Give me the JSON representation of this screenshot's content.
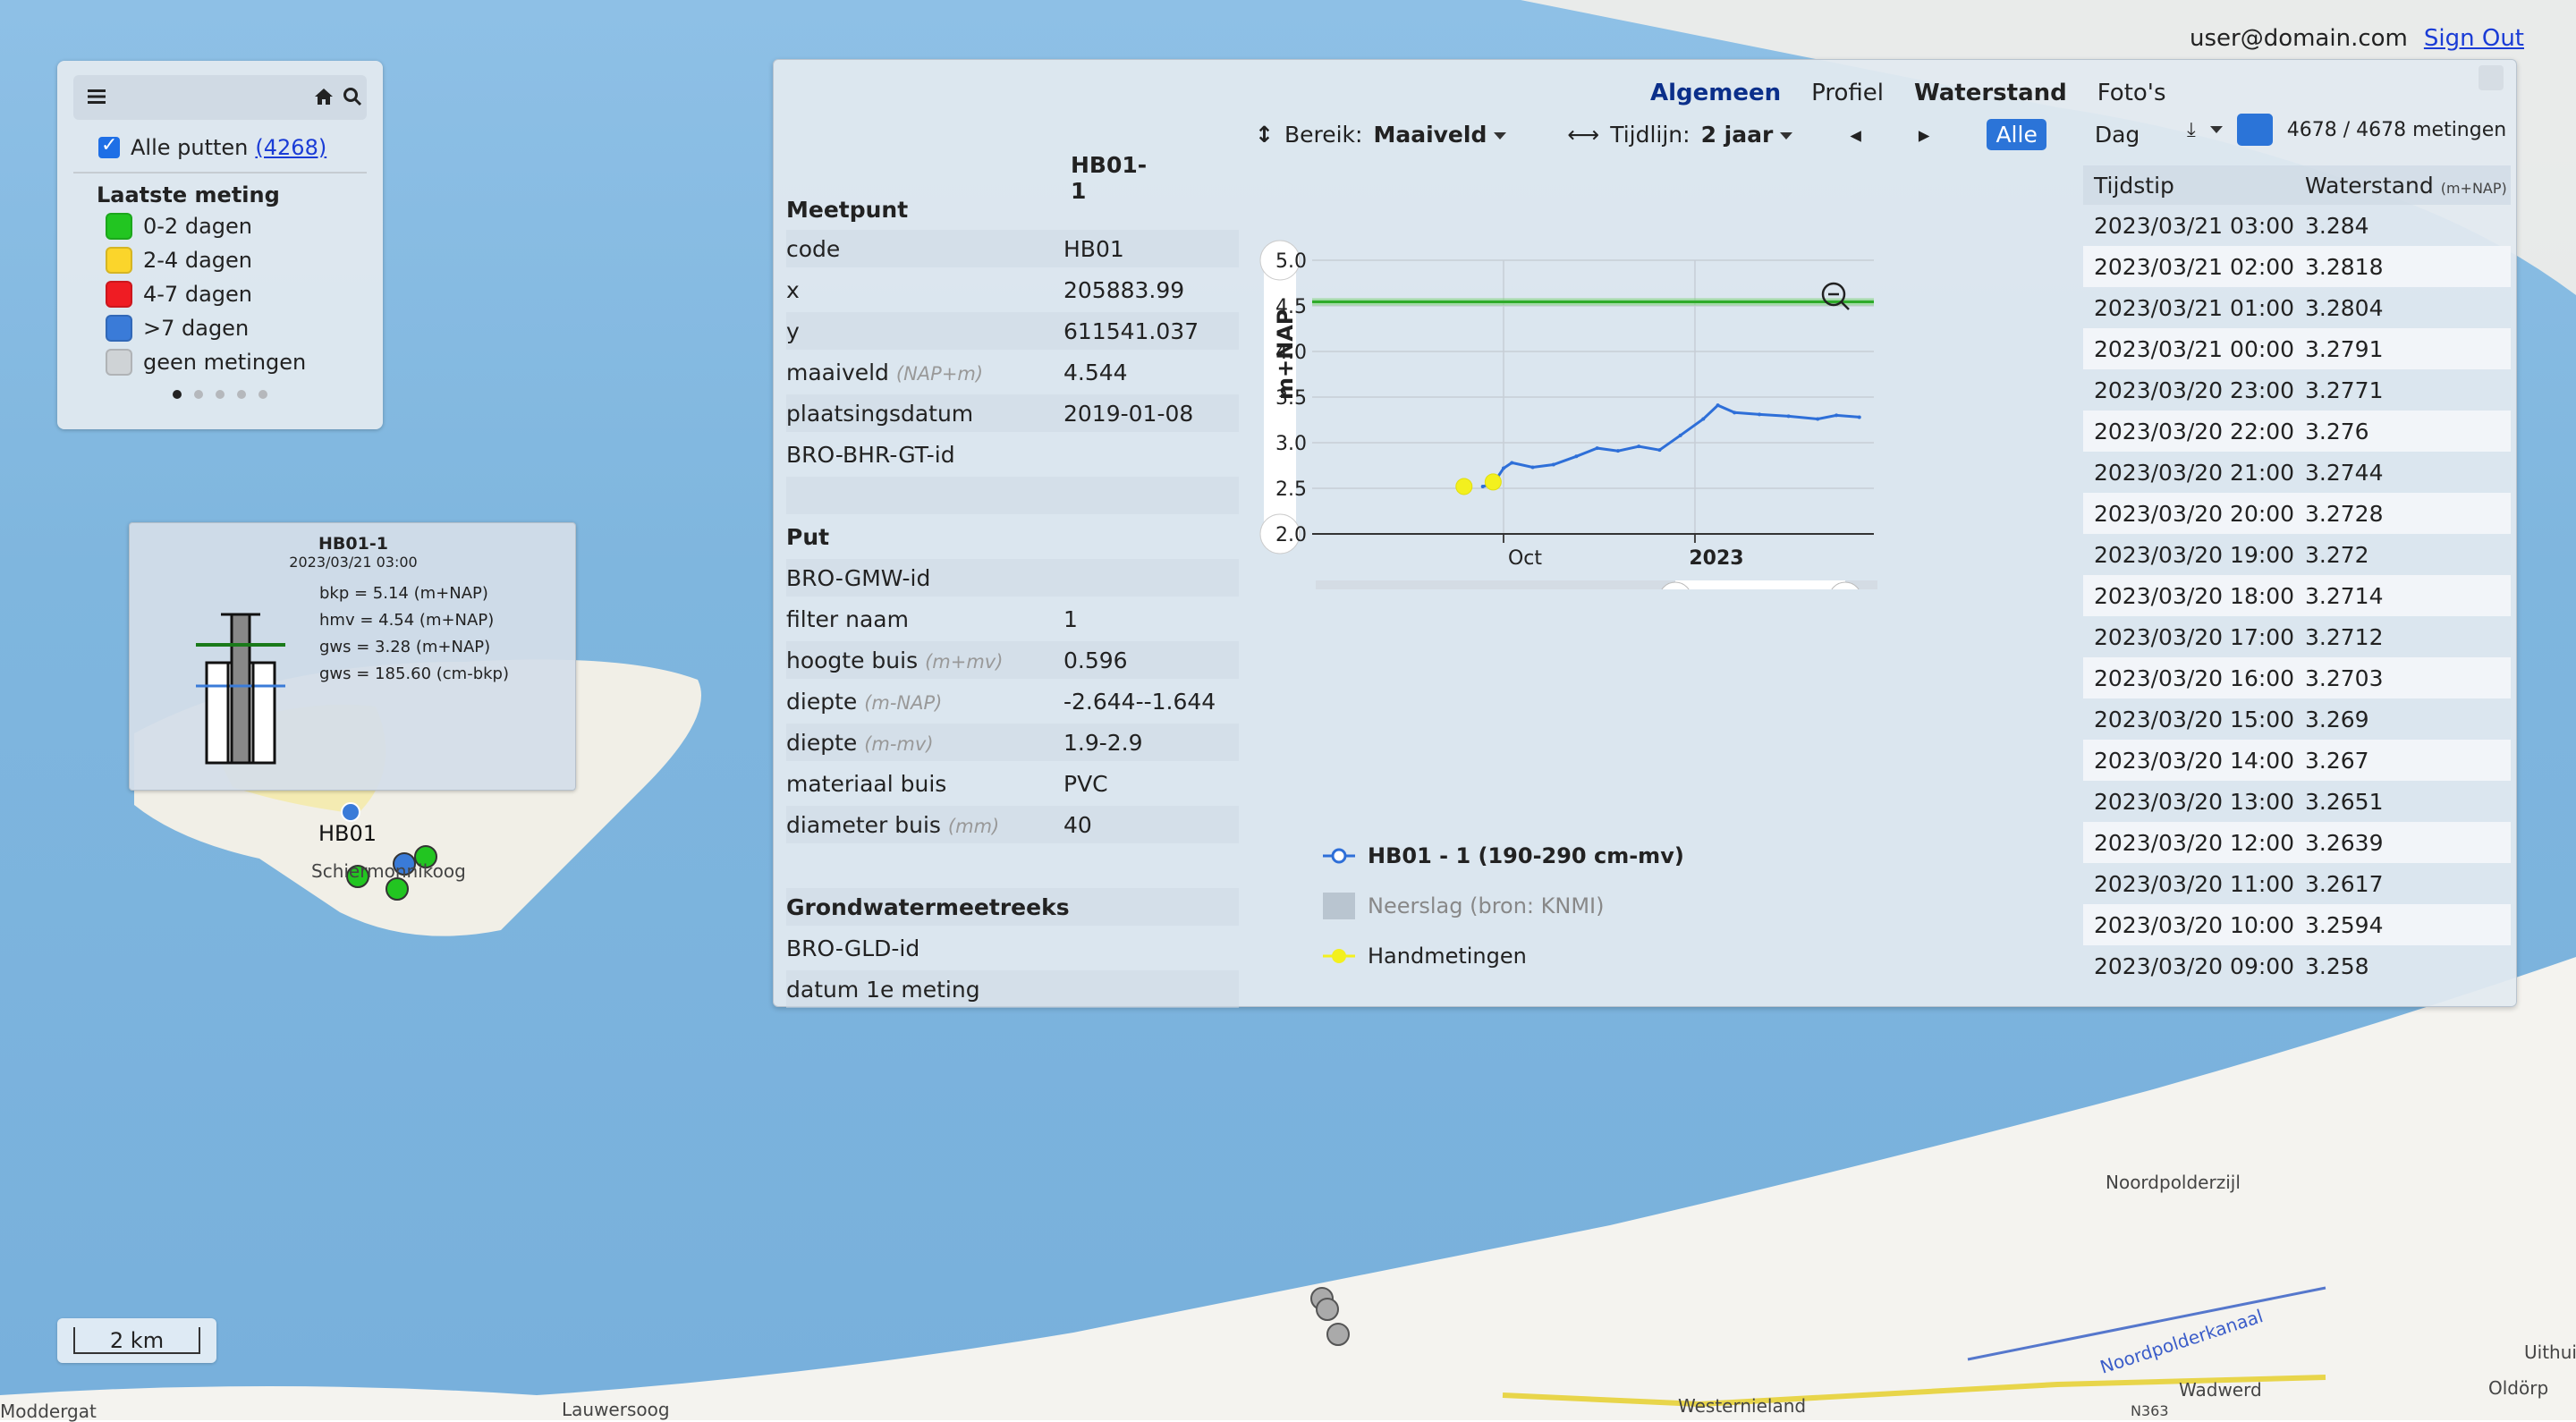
{
  "user": {
    "email": "user@domain.com",
    "signout": "Sign Out"
  },
  "legend": {
    "all_wells_label": "Alle putten",
    "all_wells_count": "(4268)",
    "title": "Laatste meting",
    "items": [
      {
        "label": "0-2 dagen",
        "color": "#22c521"
      },
      {
        "label": "2-4 dagen",
        "color": "#fbd52b"
      },
      {
        "label": "4-7 dagen",
        "color": "#ef1c23"
      },
      {
        "label": ">7 dagen",
        "color": "#3a7bd8"
      },
      {
        "label": "geen metingen",
        "color": "#cfd3d6"
      }
    ],
    "icons": [
      "menu-icon",
      "home-icon",
      "search-icon"
    ]
  },
  "popup": {
    "title": "HB01-1",
    "datetime": "2023/03/21 03:00",
    "lines": [
      "bkp = 5.14 (m+NAP)",
      "hmv = 4.54 (m+NAP)",
      "gws = 3.28 (m+NAP)",
      "gws = 185.60 (cm-bkp)"
    ]
  },
  "map": {
    "well_label": "HB01",
    "places": [
      "Schiermonnikoog",
      "Noordpolderzijl",
      "Noordpolderkanaal",
      "Wadwerd",
      "Westernieland",
      "Lauwersoog",
      "Moddergat",
      "Oldörp",
      "Uithuiz",
      "N363"
    ],
    "scale": "2 km"
  },
  "panel": {
    "tabs": [
      "Algemeen",
      "Profiel",
      "Waterstand",
      "Foto's"
    ],
    "well_id": "HB01-1",
    "sections": {
      "meetpunt": "Meetpunt",
      "put": "Put",
      "grondwater": "Grondwatermeetreeks"
    },
    "meetpunt": [
      {
        "k": "code",
        "v": "HB01"
      },
      {
        "k": "x",
        "v": "205883.99"
      },
      {
        "k": "y",
        "v": "611541.037"
      },
      {
        "k": "maaiveld",
        "unit": "(NAP+m)",
        "v": "4.544"
      },
      {
        "k": "plaatsingsdatum",
        "v": "2019-01-08"
      },
      {
        "k": "BRO-BHR-GT-id",
        "v": ""
      }
    ],
    "put": [
      {
        "k": "BRO-GMW-id",
        "v": ""
      },
      {
        "k": "filter naam",
        "v": "1"
      },
      {
        "k": "hoogte buis",
        "unit": "(m+mv)",
        "v": "0.596"
      },
      {
        "k": "diepte",
        "unit": "(m-NAP)",
        "v": "-2.644--1.644"
      },
      {
        "k": "diepte",
        "unit": "(m-mv)",
        "v": "1.9-2.9"
      },
      {
        "k": "materiaal buis",
        "v": "PVC"
      },
      {
        "k": "diameter buis",
        "unit": "(mm)",
        "v": "40"
      }
    ],
    "grondwater": [
      {
        "k": "BRO-GLD-id",
        "v": ""
      },
      {
        "k": "datum 1e meting",
        "v": ""
      }
    ],
    "controls": {
      "range_label": "Bereik:",
      "range_value": "Maaiveld",
      "timeline_label": "Tijdlijn:",
      "timeline_value": "2 jaar",
      "all": "Alle",
      "day": "Dag"
    },
    "chart_legend": [
      "HB01 - 1 (190-290 cm-mv)",
      "Neerslag (bron: KNMI)",
      "Handmetingen"
    ],
    "meas_count": "4678 / 4678 metingen",
    "table": {
      "col1": "Tijdstip",
      "col2": "Waterstand",
      "col2_unit": "(m+NAP)",
      "rows": [
        [
          "2023/03/21 03:00",
          "3.284"
        ],
        [
          "2023/03/21 02:00",
          "3.2818"
        ],
        [
          "2023/03/21 01:00",
          "3.2804"
        ],
        [
          "2023/03/21 00:00",
          "3.2791"
        ],
        [
          "2023/03/20 23:00",
          "3.2771"
        ],
        [
          "2023/03/20 22:00",
          "3.276"
        ],
        [
          "2023/03/20 21:00",
          "3.2744"
        ],
        [
          "2023/03/20 20:00",
          "3.2728"
        ],
        [
          "2023/03/20 19:00",
          "3.272"
        ],
        [
          "2023/03/20 18:00",
          "3.2714"
        ],
        [
          "2023/03/20 17:00",
          "3.2712"
        ],
        [
          "2023/03/20 16:00",
          "3.2703"
        ],
        [
          "2023/03/20 15:00",
          "3.269"
        ],
        [
          "2023/03/20 14:00",
          "3.267"
        ],
        [
          "2023/03/20 13:00",
          "3.2651"
        ],
        [
          "2023/03/20 12:00",
          "3.2639"
        ],
        [
          "2023/03/20 11:00",
          "3.2617"
        ],
        [
          "2023/03/20 10:00",
          "3.2594"
        ],
        [
          "2023/03/20 09:00",
          "3.258"
        ]
      ]
    }
  },
  "chart_data": {
    "type": "line",
    "ylabel": "m+NAP",
    "ylim": [
      2.0,
      5.0
    ],
    "yticks": [
      "2.0",
      "2.5",
      "3.0",
      "3.5",
      "4.0",
      "4.5",
      "5.0"
    ],
    "xticks": [
      "Oct",
      "2023"
    ],
    "maaiveld": 4.544,
    "navigator_label": "2023",
    "series": [
      {
        "name": "HB01 - 1 (190-290 cm-mv)",
        "color": "#2e6fd8",
        "x": [
          "2022-09-21",
          "2022-09-26",
          "2022-10-01",
          "2022-10-05",
          "2022-10-15",
          "2022-10-25",
          "2022-11-05",
          "2022-11-15",
          "2022-11-25",
          "2022-12-05",
          "2022-12-15",
          "2022-12-25",
          "2023-01-05",
          "2023-01-12",
          "2023-01-20",
          "2023-02-01",
          "2023-02-15",
          "2023-03-01",
          "2023-03-10",
          "2023-03-21"
        ],
        "y": [
          2.52,
          2.55,
          2.72,
          2.78,
          2.73,
          2.76,
          2.85,
          2.94,
          2.91,
          2.96,
          2.92,
          3.08,
          3.26,
          3.41,
          3.33,
          3.31,
          3.29,
          3.26,
          3.3,
          3.28
        ]
      },
      {
        "name": "Handmetingen",
        "color": "#f3f01e",
        "x": [
          "2022-09-12",
          "2022-09-26"
        ],
        "y": [
          2.52,
          2.57
        ]
      }
    ]
  }
}
